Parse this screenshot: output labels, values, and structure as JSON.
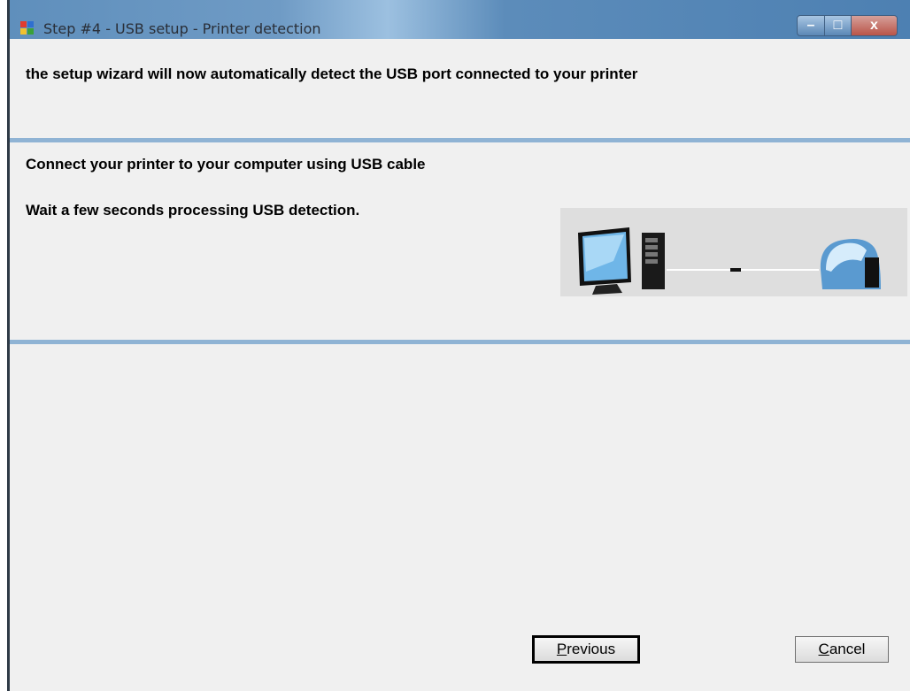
{
  "window": {
    "title": "Step #4 - USB setup - Printer detection",
    "controls": {
      "minimize": "–",
      "maximize": "□",
      "close": "x"
    }
  },
  "header": {
    "text": "the setup wizard will now automatically detect the USB port connected to your printer"
  },
  "instructions": {
    "line1": "Connect your printer to your computer using USB cable",
    "line2": "Wait a few seconds processing USB detection."
  },
  "illustration": {
    "icons": [
      "computer-monitor-icon",
      "pc-tower-icon",
      "usb-cable-icon",
      "card-printer-icon"
    ]
  },
  "buttons": {
    "previous": {
      "mnemonic": "P",
      "rest": "revious"
    },
    "cancel": {
      "mnemonic": "C",
      "rest": "ancel"
    }
  },
  "colors": {
    "separator": "#8fb3d4",
    "panel_bg": "#f0f0f0",
    "titlebar": "#5f8fbc"
  }
}
